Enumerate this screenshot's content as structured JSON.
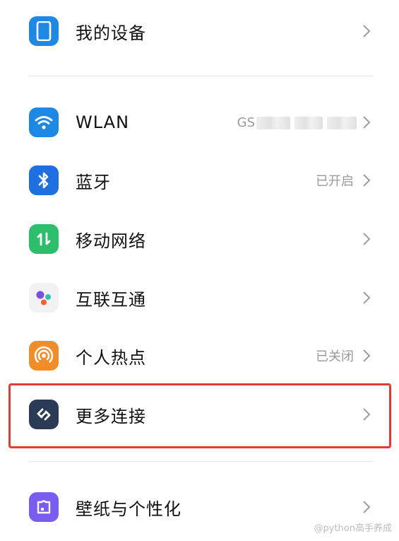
{
  "items": [
    {
      "label": "我的设备",
      "value": "",
      "icon": "phone-icon",
      "color": "#1E88E5"
    },
    {
      "label": "WLAN",
      "value": "GS",
      "icon": "wifi-icon",
      "color": "#1E88E5"
    },
    {
      "label": "蓝牙",
      "value": "已开启",
      "icon": "bluetooth-icon",
      "color": "#1E6FE0"
    },
    {
      "label": "移动网络",
      "value": "",
      "icon": "mobile-data-icon",
      "color": "#2DBE6C"
    },
    {
      "label": "互联互通",
      "value": "",
      "icon": "interconnect-icon",
      "color": "#F2F2F5"
    },
    {
      "label": "个人热点",
      "value": "已关闭",
      "icon": "hotspot-icon",
      "color": "#F28C28"
    },
    {
      "label": "更多连接",
      "value": "",
      "icon": "link-icon",
      "color": "#2B3A55"
    },
    {
      "label": "壁纸与个性化",
      "value": "",
      "icon": "wallpaper-icon",
      "color": "#7B5CF0"
    }
  ],
  "highlight_color": "#E53935",
  "watermark": "@python高手养成"
}
